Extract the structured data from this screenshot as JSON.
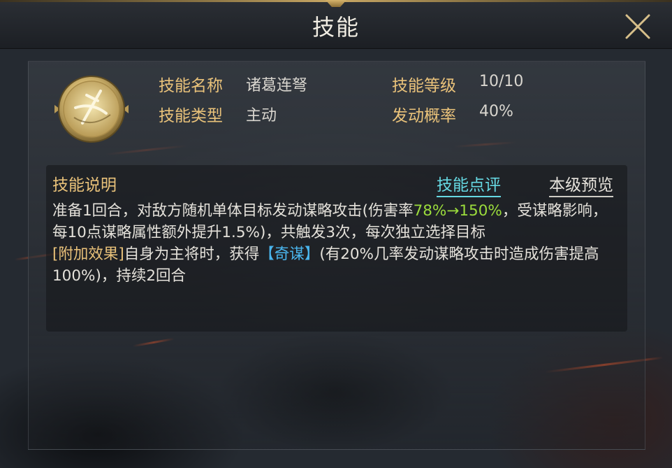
{
  "window": {
    "title": "技能"
  },
  "skill": {
    "icon": "crossbow-emblem-icon",
    "fields": [
      {
        "label": "技能名称",
        "value": "诸葛连弩"
      },
      {
        "label": "技能类型",
        "value": "主动"
      },
      {
        "label": "技能等级",
        "value": "10/10"
      },
      {
        "label": "发动概率",
        "value": "40%"
      }
    ]
  },
  "description": {
    "title": "技能说明",
    "review_link": "技能点评",
    "preview_link": "本级预览",
    "line1_a": "准备1回合，对敌方随机单体目标发动谋略攻击(伤害率",
    "line1_highlight": "78%→150%",
    "line1_b": "，受谋略影响，每10点谋略属性额外提升1.5%)，共触发3次，每次独立选择目标",
    "line2_tag": "[附加效果]",
    "line2_a": "自身为主将时，获得",
    "line2_buff": "【奇谋】",
    "line2_b": "(有20%几率发动谋略攻击时造成伤害提高100%)，持续2回合"
  },
  "colors": {
    "label_gold": "#e9c27a",
    "highlight_green": "#9bdc3c",
    "buff_blue": "#4ab6ee",
    "link_cyan": "#66d8e2"
  }
}
